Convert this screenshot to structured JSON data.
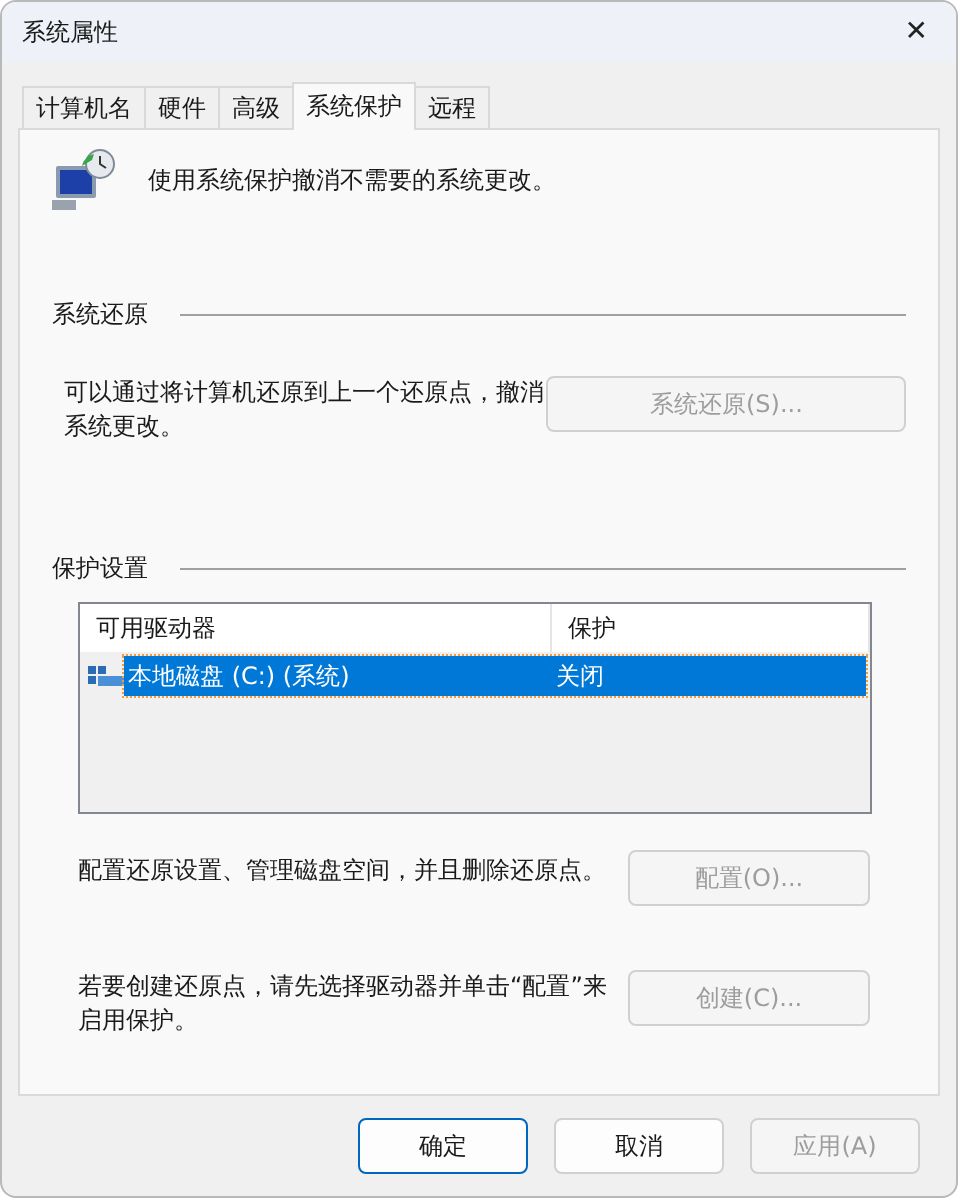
{
  "window": {
    "title": "系统属性",
    "close": "✕"
  },
  "tabs": [
    {
      "label": "计算机名",
      "selected": false
    },
    {
      "label": "硬件",
      "selected": false
    },
    {
      "label": "高级",
      "selected": false
    },
    {
      "label": "系统保护",
      "selected": true
    },
    {
      "label": "远程",
      "selected": false
    }
  ],
  "intro": "使用系统保护撤消不需要的系统更改。",
  "restore": {
    "heading": "系统还原",
    "text": "可以通过将计算机还原到上一个还原点，撤消系统更改。",
    "button": {
      "label": "系统还原(S)...",
      "disabled": true
    }
  },
  "protection": {
    "heading": "保护设置",
    "table": {
      "columns": [
        "可用驱动器",
        "保护"
      ],
      "rows": [
        {
          "drive": "本地磁盘 (C:) (系统)",
          "protection": "关闭",
          "selected": true
        }
      ]
    },
    "configure": {
      "text": "配置还原设置、管理磁盘空间，并且删除还原点。",
      "button": {
        "label": "配置(O)...",
        "disabled": true
      }
    },
    "create": {
      "text": "若要创建还原点，请先选择驱动器并单击“配置”来启用保护。",
      "button": {
        "label": "创建(C)...",
        "disabled": true
      }
    }
  },
  "buttons": [
    {
      "label": "确定",
      "default": true,
      "disabled": false
    },
    {
      "label": "取消",
      "default": false,
      "disabled": false
    },
    {
      "label": "应用(A)",
      "default": false,
      "disabled": true
    }
  ]
}
